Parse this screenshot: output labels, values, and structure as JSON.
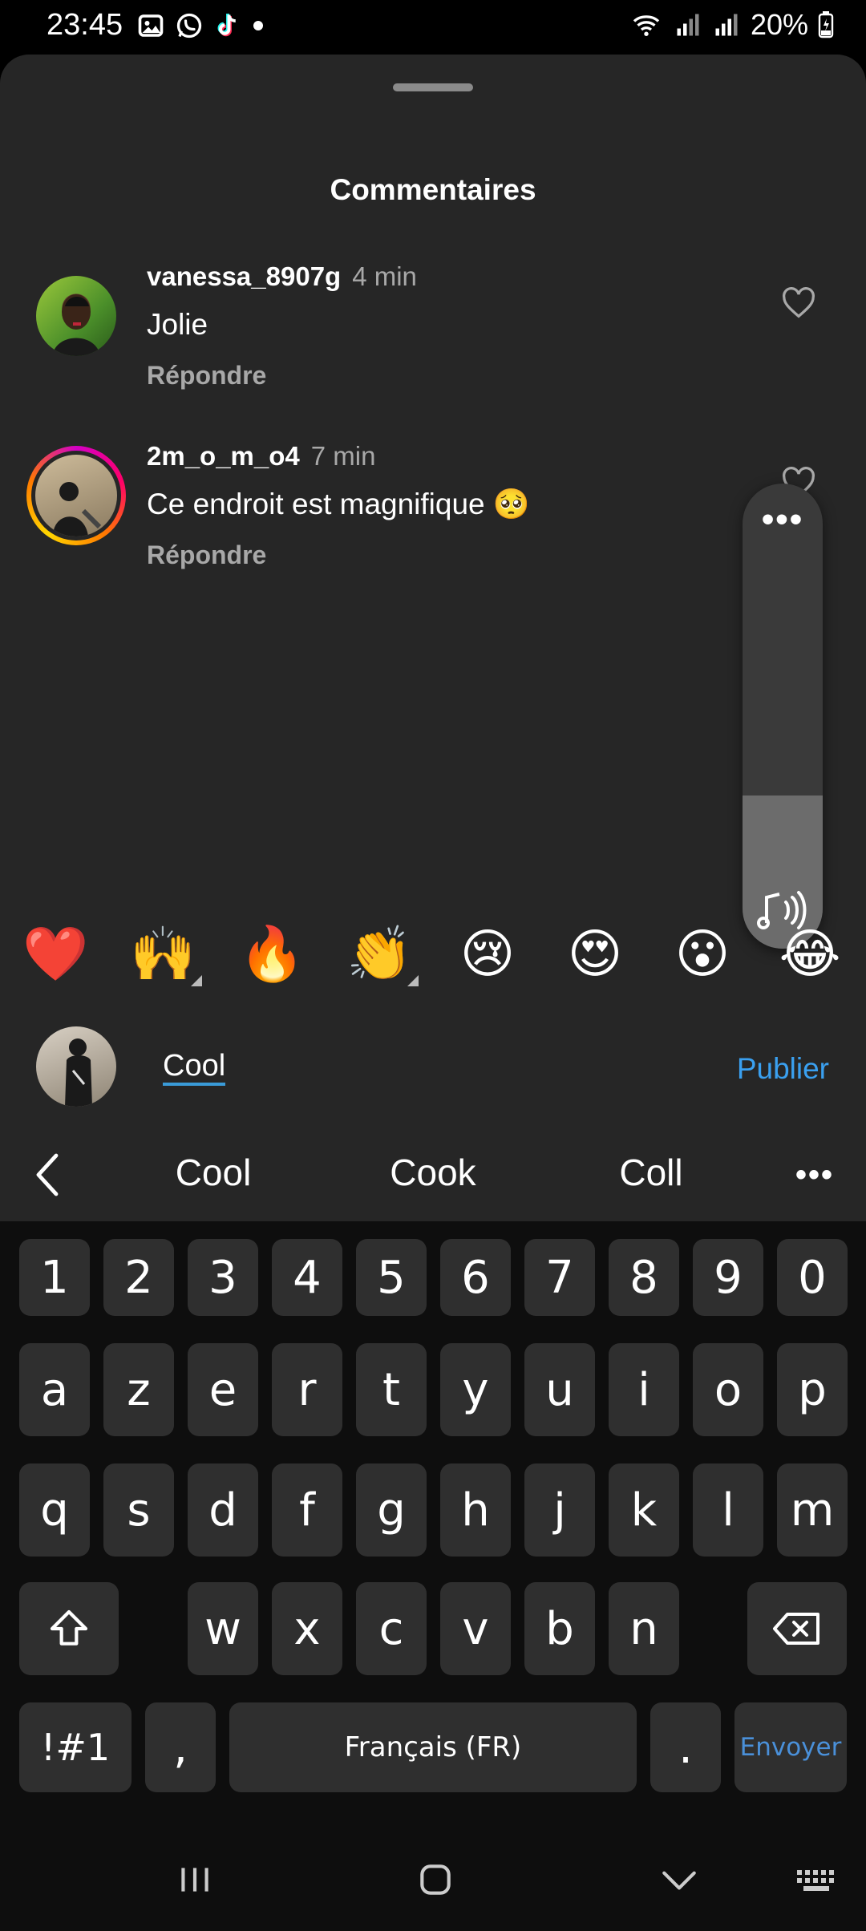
{
  "status_bar": {
    "time": "23:45",
    "battery": "20%",
    "left_icons": [
      "gallery-icon",
      "whatsapp-icon",
      "tiktok-icon",
      "dot-icon"
    ],
    "right_icons": [
      "wifi-icon",
      "signal-icon",
      "signal-icon",
      "battery-icon"
    ]
  },
  "sheet": {
    "title": "Commentaires"
  },
  "comments": [
    {
      "username": "vanessa_8907g",
      "time": "4 min",
      "text": "Jolie",
      "reply_label": "Répondre"
    },
    {
      "username": "2m_o_m_o4",
      "time": "7 min",
      "text": "Ce endroit est magnifique 🥺",
      "reply_label": "Répondre"
    }
  ],
  "volume": {
    "more_label": "•••",
    "level": 0.33
  },
  "emoji_bar": [
    "❤️",
    "🙌",
    "🔥",
    "👏",
    "😢",
    "😍",
    "😮",
    "😂"
  ],
  "comment_input": {
    "value": "Cool",
    "publish_label": "Publier"
  },
  "suggestions": {
    "items": [
      "Cool",
      "Cook",
      "Coll"
    ],
    "more_label": "•••"
  },
  "keyboard": {
    "row_numbers": [
      "1",
      "2",
      "3",
      "4",
      "5",
      "6",
      "7",
      "8",
      "9",
      "0"
    ],
    "row1": [
      "a",
      "z",
      "e",
      "r",
      "t",
      "y",
      "u",
      "i",
      "o",
      "p"
    ],
    "row2": [
      "q",
      "s",
      "d",
      "f",
      "g",
      "h",
      "j",
      "k",
      "l",
      "m"
    ],
    "row3": [
      "w",
      "x",
      "c",
      "v",
      "b",
      "n"
    ],
    "symbols_label": "!#1",
    "comma_label": ",",
    "space_label": "Français (FR)",
    "period_label": ".",
    "enter_label": "Envoyer"
  },
  "colors": {
    "sheet_bg": "#262626",
    "accent_blue": "#3aa0f0",
    "keyboard_bg": "#0e0e0e",
    "key_bg": "#2f2f2f"
  }
}
